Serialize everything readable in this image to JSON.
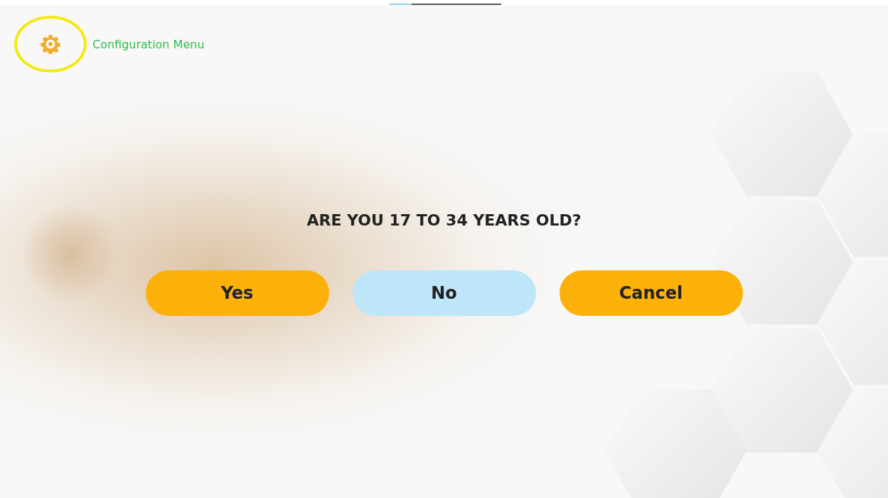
{
  "progress": {
    "level": 0.2
  },
  "config": {
    "label": "Configuration Menu",
    "highlighted": true
  },
  "question": "ARE YOU 17 TO 34 YEARS OLD?",
  "buttons": [
    {
      "label": "Yes",
      "selected": false
    },
    {
      "label": "No",
      "selected": true
    },
    {
      "label": "Cancel",
      "selected": false
    }
  ]
}
